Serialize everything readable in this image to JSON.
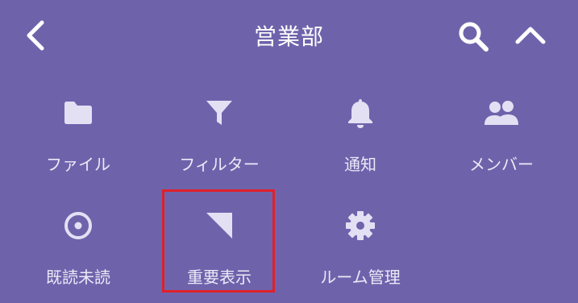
{
  "header": {
    "back_icon": "chevron-left-icon",
    "title": "営業部",
    "search_icon": "search-icon",
    "collapse_icon": "chevron-up-icon"
  },
  "menu": {
    "items": [
      {
        "label": "ファイル",
        "icon": "folder-icon"
      },
      {
        "label": "フィルター",
        "icon": "filter-icon"
      },
      {
        "label": "通知",
        "icon": "bell-icon"
      },
      {
        "label": "メンバー",
        "icon": "people-icon"
      },
      {
        "label": "既読未読",
        "icon": "radio-target-icon"
      },
      {
        "label": "重要表示",
        "icon": "corner-flag-icon"
      },
      {
        "label": "ルーム管理",
        "icon": "gear-icon"
      }
    ]
  },
  "colors": {
    "background": "#6e63ab",
    "icon": "#e4e0f4",
    "text": "#ece9f7",
    "highlight_border": "#e0202a"
  }
}
